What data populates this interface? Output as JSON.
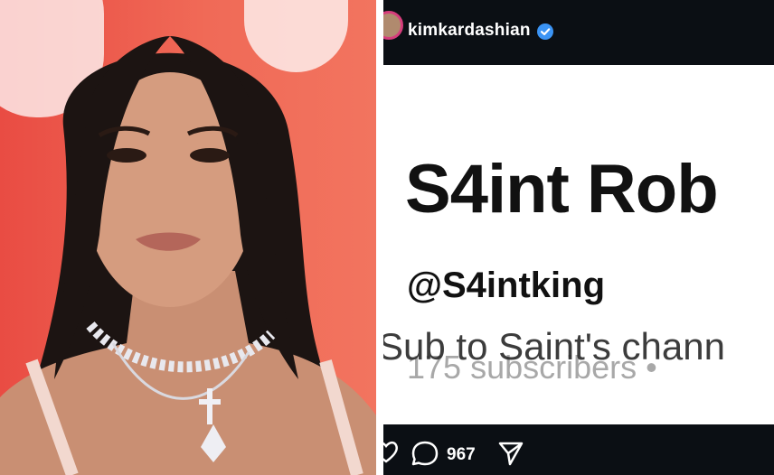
{
  "post": {
    "username": "kimkardashian",
    "comment_count": "967"
  },
  "screenshot": {
    "channel_name": "S4int Rob",
    "handle": "@S4intking",
    "caption_overlay": "Sub to Saint's chann",
    "subscribers_text": "175 subscribers  •"
  },
  "colors": {
    "dark_bar": "#0b0f14",
    "verified_blue": "#3b94f5",
    "photo_backdrop": "#ef5f4f"
  },
  "icons": {
    "verified": "verified-badge-icon",
    "like": "heart-icon",
    "comment": "comment-icon",
    "share": "paper-plane-icon"
  }
}
